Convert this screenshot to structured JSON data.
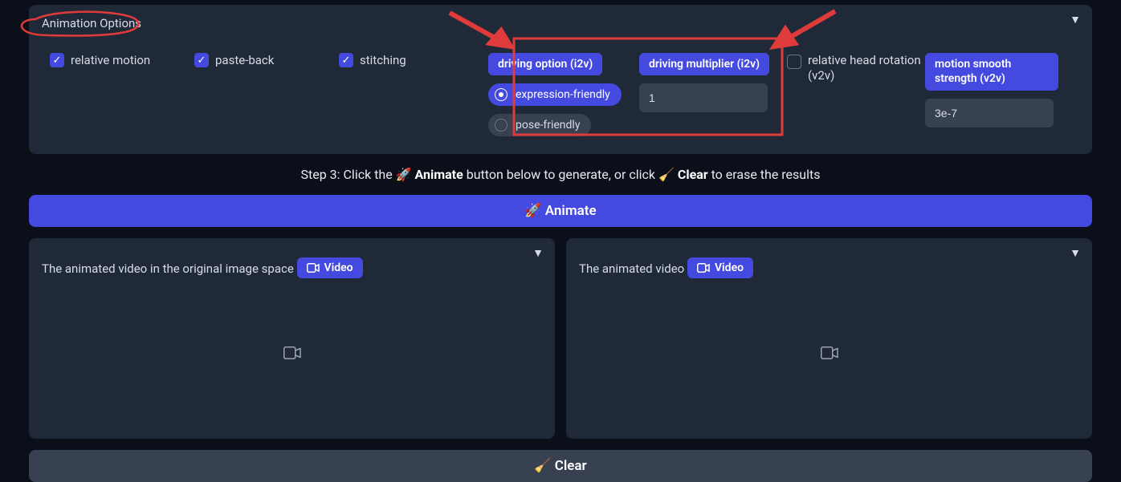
{
  "panel": {
    "title": "Animation Options",
    "collapse_glyph": "▼"
  },
  "checks": {
    "relative_motion": "relative motion",
    "paste_back": "paste-back",
    "stitching": "stitching",
    "relative_head_rotation": "relative head rotation (v2v)"
  },
  "driving_option": {
    "chip": "driving option (i2v)",
    "opt1": "expression-friendly",
    "opt2": "pose-friendly"
  },
  "driving_multiplier": {
    "chip": "driving multiplier (i2v)",
    "value": "1"
  },
  "motion_smooth": {
    "chip": "motion smooth strength (v2v)",
    "value": "3e-7"
  },
  "step3": {
    "prefix": "Step 3: Click the 🚀 ",
    "animate": "Animate",
    "mid": " button below to generate, or click 🧹 ",
    "clear": "Clear",
    "suffix": " to erase the results"
  },
  "buttons": {
    "animate": "🚀 Animate",
    "clear": "🧹 Clear"
  },
  "videos": {
    "left_title": "The animated video in the original image space",
    "right_title": "The animated video",
    "pill": "Video"
  }
}
